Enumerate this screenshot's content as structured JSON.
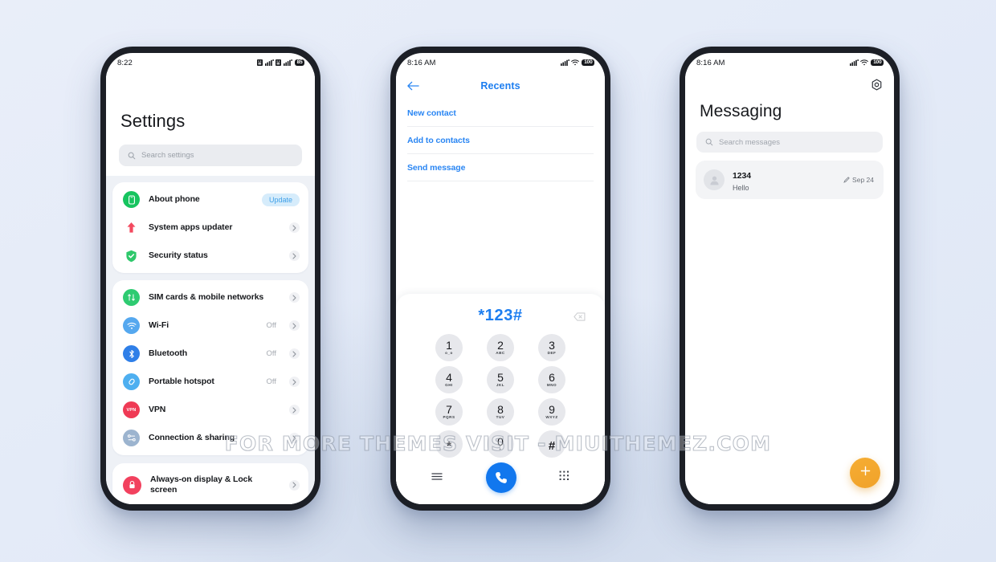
{
  "background_color": "#e4ebf8",
  "watermark": "FOR MORE THEMES VISIT - MIUITHEMEZ.COM",
  "phones": {
    "settings": {
      "status_bar": {
        "time": "8:22",
        "battery": "85"
      },
      "title": "Settings",
      "search_placeholder": "Search settings",
      "groups": [
        {
          "items": [
            {
              "label": "About phone",
              "icon": "phone-icon",
              "icon_color": "#16c45f",
              "badge": "Update",
              "value": "",
              "chevron": false
            },
            {
              "label": "System apps updater",
              "icon": "up-arrow-icon",
              "icon_color": "#ffffff",
              "value": "",
              "chevron": true
            },
            {
              "label": "Security status",
              "icon": "shield-check-icon",
              "icon_color": "#ffffff",
              "value": "",
              "chevron": true
            }
          ]
        },
        {
          "items": [
            {
              "label": "SIM cards & mobile networks",
              "icon": "sim-swap-icon",
              "icon_color": "#2ecb71",
              "value": "",
              "chevron": true
            },
            {
              "label": "Wi-Fi",
              "icon": "wifi-icon",
              "icon_color": "#55a8ef",
              "value": "Off",
              "chevron": true
            },
            {
              "label": "Bluetooth",
              "icon": "bluetooth-icon",
              "icon_color": "#2f7fe8",
              "value": "Off",
              "chevron": true
            },
            {
              "label": "Portable hotspot",
              "icon": "hotspot-link-icon",
              "icon_color": "#4eaff0",
              "value": "Off",
              "chevron": true
            },
            {
              "label": "VPN",
              "icon": "vpn-icon",
              "icon_color": "#ef3a55",
              "value": "",
              "chevron": true
            },
            {
              "label": "Connection & sharing",
              "icon": "connection-share-icon",
              "icon_color": "#9cb4cf",
              "value": "",
              "chevron": true
            }
          ]
        },
        {
          "items": [
            {
              "label": "Always-on display & Lock screen",
              "icon": "lock-icon",
              "icon_color": "#f2415e",
              "value": "",
              "chevron": true
            }
          ]
        }
      ]
    },
    "dialer": {
      "status_bar": {
        "time": "8:16 AM",
        "battery": "100"
      },
      "header_title": "Recents",
      "back_icon": "back-arrow-icon",
      "actions": [
        "New contact",
        "Add to contacts",
        "Send message"
      ],
      "dialed_number": "*123#",
      "delete_icon": "backspace-icon",
      "keys": [
        {
          "digit": "1",
          "sub": "o_o"
        },
        {
          "digit": "2",
          "sub": "ABC"
        },
        {
          "digit": "3",
          "sub": "DEF"
        },
        {
          "digit": "4",
          "sub": "GHI"
        },
        {
          "digit": "5",
          "sub": "JKL"
        },
        {
          "digit": "6",
          "sub": "MNO"
        },
        {
          "digit": "7",
          "sub": "PQRS"
        },
        {
          "digit": "8",
          "sub": "TUV"
        },
        {
          "digit": "9",
          "sub": "WXYZ"
        },
        {
          "digit": "*",
          "sub": ""
        },
        {
          "digit": "0",
          "sub": "+"
        },
        {
          "digit": "#",
          "sub": ""
        }
      ],
      "bottom_bar": {
        "menu_icon": "hamburger-menu-icon",
        "call_icon": "phone-call-icon",
        "keypad_icon": "dialpad-icon",
        "call_button_color": "#1177ee"
      }
    },
    "messaging": {
      "status_bar": {
        "time": "8:16 AM",
        "battery": "100"
      },
      "settings_icon": "gear-icon",
      "title": "Messaging",
      "search_placeholder": "Search messages",
      "threads": [
        {
          "name": "1234",
          "preview": "Hello",
          "date": "Sep 24",
          "status_icon": "pencil-icon",
          "avatar": "person-avatar-icon"
        }
      ],
      "fab": {
        "icon": "plus-icon",
        "color": "#f3a62c"
      }
    }
  }
}
